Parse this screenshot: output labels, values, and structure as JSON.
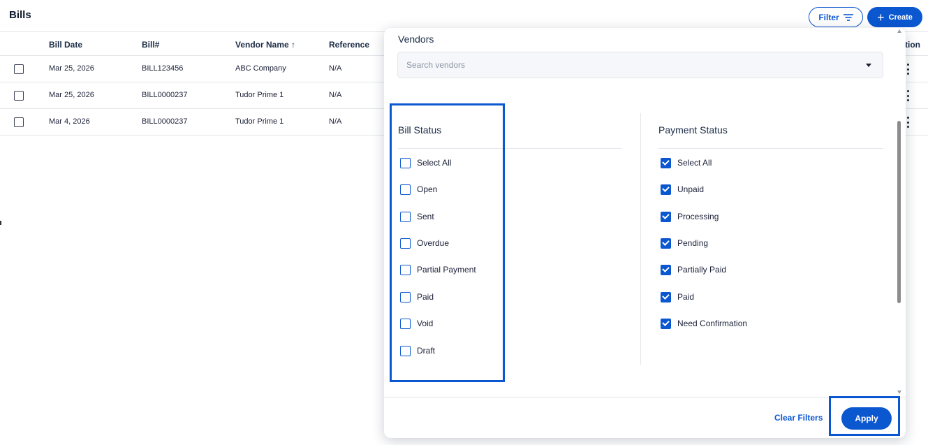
{
  "header": {
    "title": "Bills",
    "filter_label": "Filter",
    "create_label": "Create"
  },
  "table": {
    "columns": {
      "bill_date": "Bill Date",
      "bill_no": "Bill#",
      "vendor": "Vendor Name ↑",
      "reference": "Reference",
      "action": "tion"
    },
    "rows": [
      {
        "date": "Mar 25, 2026",
        "bill": "BILL123456",
        "vendor": "ABC Company",
        "reference": "N/A"
      },
      {
        "date": "Mar 25, 2026",
        "bill": "BILL0000237",
        "vendor": "Tudor Prime 1",
        "reference": "N/A"
      },
      {
        "date": "Mar 4, 2026",
        "bill": "BILL0000237",
        "vendor": "Tudor Prime 1",
        "reference": "N/A"
      }
    ]
  },
  "filter_panel": {
    "vendors_label": "Vendors",
    "vendor_placeholder": "Search vendors",
    "bill_status": {
      "heading": "Bill Status",
      "options": [
        {
          "label": "Select All",
          "checked": false
        },
        {
          "label": "Open",
          "checked": false
        },
        {
          "label": "Sent",
          "checked": false
        },
        {
          "label": "Overdue",
          "checked": false
        },
        {
          "label": "Partial Payment",
          "checked": false
        },
        {
          "label": "Paid",
          "checked": false
        },
        {
          "label": "Void",
          "checked": false
        },
        {
          "label": "Draft",
          "checked": false
        }
      ]
    },
    "payment_status": {
      "heading": "Payment Status",
      "options": [
        {
          "label": "Select All",
          "checked": true
        },
        {
          "label": "Unpaid",
          "checked": true
        },
        {
          "label": "Processing",
          "checked": true
        },
        {
          "label": "Pending",
          "checked": true
        },
        {
          "label": "Partially Paid",
          "checked": true
        },
        {
          "label": "Paid",
          "checked": true
        },
        {
          "label": "Need Confirmation",
          "checked": true
        }
      ]
    },
    "clear_label": "Clear Filters",
    "apply_label": "Apply"
  },
  "colors": {
    "accent": "#0b57d0",
    "text": "#1a1f36",
    "divider": "#e3e6ea"
  }
}
